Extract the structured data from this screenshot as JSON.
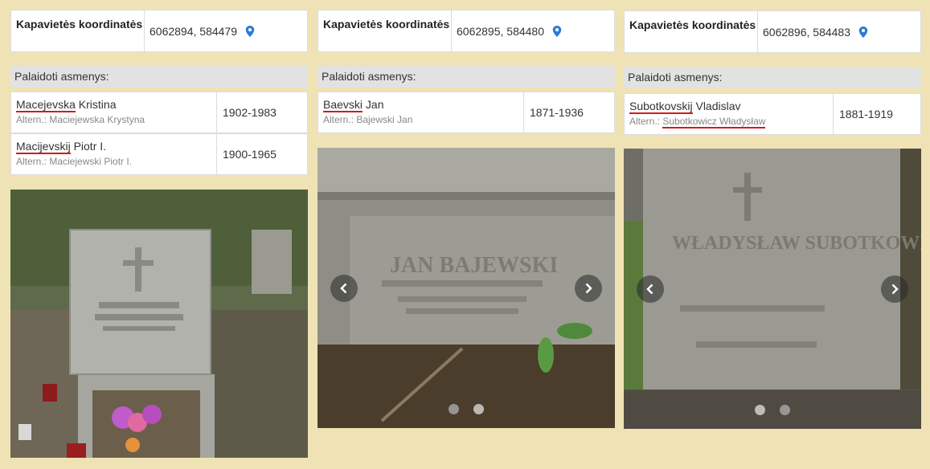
{
  "grave1": {
    "coord_label": "Kapavietės koordinatės",
    "coord_value": "6062894, 584479",
    "buried_header": "Palaidoti asmenys:",
    "persons": [
      {
        "name_a": "Macejevska",
        "name_b": " Kristina",
        "alt_a": "Altern.: Maciejewska Krystyna",
        "years": "1902-1983"
      },
      {
        "name_a": "Macijevskij",
        "name_b": " Piotr I.",
        "alt_a": "Altern.: Maciejewski Piotr I.",
        "years": "1900-1965"
      }
    ]
  },
  "grave2": {
    "coord_label": "Kapavietės koordinatės",
    "coord_value": "6062895, 584480",
    "buried_header": "Palaidoti asmenys:",
    "persons": [
      {
        "name_a": "Baevski",
        "name_b": " Jan",
        "alt_a": "Altern.: Bajewski Jan",
        "years": "1871-1936"
      }
    ],
    "stone_text": "JAN BAJEWSKI"
  },
  "grave3": {
    "coord_label": "Kapavietės koordinatės",
    "coord_value": "6062896, 584483",
    "buried_header": "Palaidoti asmenys:",
    "persons": [
      {
        "name_a": "Subotkovskij",
        "name_b": " Vladislav",
        "alt_pre": "Altern.: ",
        "alt_a": "Subotkowicz Władysław",
        "years": "1881-1919"
      }
    ],
    "stone_text": "WŁADYSŁAW SUBOTKOWICZ"
  },
  "icons": {
    "location": "map-pin-icon",
    "prev": "chevron-left-icon",
    "next": "chevron-right-icon"
  },
  "colors": {
    "background": "#efe3b5",
    "underline": "#d41b1b",
    "pin": "#2b7bd6"
  }
}
